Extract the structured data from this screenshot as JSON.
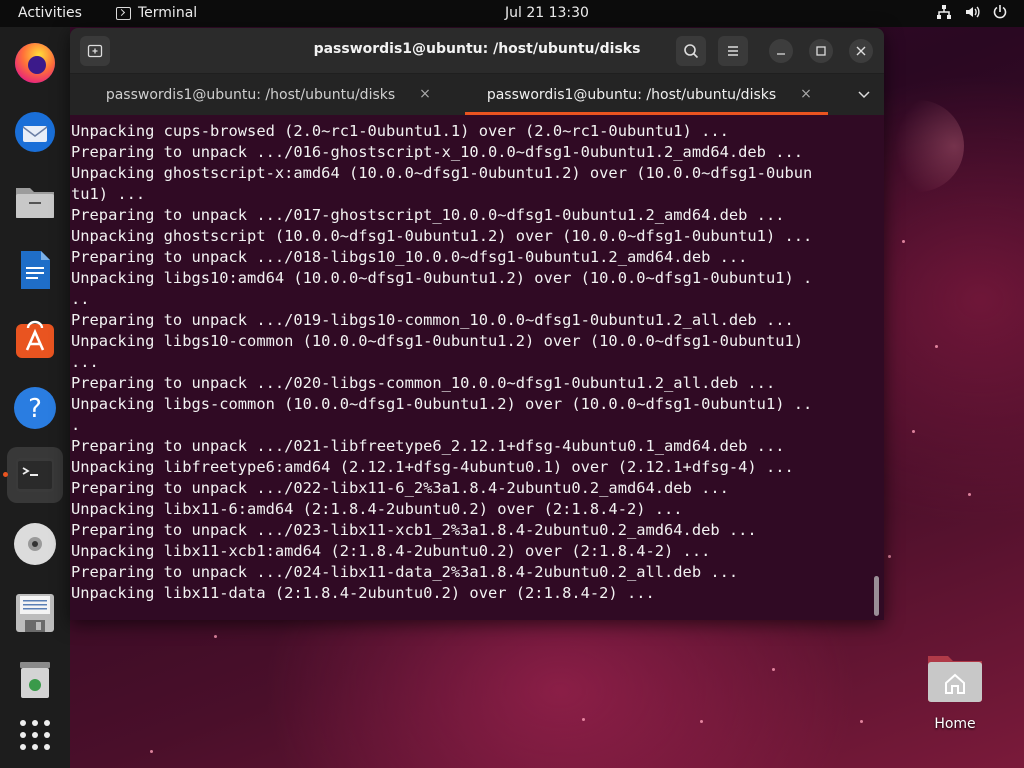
{
  "topbar": {
    "activities": "Activities",
    "app_name": "Terminal",
    "clock": "Jul 21  13:30"
  },
  "dock": {
    "items": [
      {
        "name": "firefox",
        "icon": "firefox-icon"
      },
      {
        "name": "thunderbird",
        "icon": "thunderbird-icon"
      },
      {
        "name": "files",
        "icon": "files-icon"
      },
      {
        "name": "libreoffice-writer",
        "icon": "writer-icon"
      },
      {
        "name": "app-center",
        "icon": "app-center-icon"
      },
      {
        "name": "help",
        "icon": "help-icon"
      },
      {
        "name": "terminal",
        "icon": "terminal-icon"
      },
      {
        "name": "cd-drive",
        "icon": "disc-icon"
      },
      {
        "name": "floppy",
        "icon": "floppy-icon"
      },
      {
        "name": "trash",
        "icon": "trash-icon"
      },
      {
        "name": "show-apps",
        "icon": "grid-icon"
      }
    ]
  },
  "window": {
    "title": "passwordis1@ubuntu: /host/ubuntu/disks",
    "tabs": [
      {
        "label": "passwordis1@ubuntu: /host/ubuntu/disks",
        "active": false
      },
      {
        "label": "passwordis1@ubuntu: /host/ubuntu/disks",
        "active": true
      }
    ],
    "close_glyph": "×"
  },
  "terminal": {
    "lines": [
      "Unpacking cups-browsed (2.0~rc1-0ubuntu1.1) over (2.0~rc1-0ubuntu1) ...",
      "Preparing to unpack .../016-ghostscript-x_10.0.0~dfsg1-0ubuntu1.2_amd64.deb ...",
      "Unpacking ghostscript-x:amd64 (10.0.0~dfsg1-0ubuntu1.2) over (10.0.0~dfsg1-0ubun",
      "tu1) ...",
      "Preparing to unpack .../017-ghostscript_10.0.0~dfsg1-0ubuntu1.2_amd64.deb ...",
      "Unpacking ghostscript (10.0.0~dfsg1-0ubuntu1.2) over (10.0.0~dfsg1-0ubuntu1) ...",
      "Preparing to unpack .../018-libgs10_10.0.0~dfsg1-0ubuntu1.2_amd64.deb ...",
      "Unpacking libgs10:amd64 (10.0.0~dfsg1-0ubuntu1.2) over (10.0.0~dfsg1-0ubuntu1) .",
      "..",
      "Preparing to unpack .../019-libgs10-common_10.0.0~dfsg1-0ubuntu1.2_all.deb ...",
      "Unpacking libgs10-common (10.0.0~dfsg1-0ubuntu1.2) over (10.0.0~dfsg1-0ubuntu1)",
      "...",
      "Preparing to unpack .../020-libgs-common_10.0.0~dfsg1-0ubuntu1.2_all.deb ...",
      "Unpacking libgs-common (10.0.0~dfsg1-0ubuntu1.2) over (10.0.0~dfsg1-0ubuntu1) ..",
      ".",
      "Preparing to unpack .../021-libfreetype6_2.12.1+dfsg-4ubuntu0.1_amd64.deb ...",
      "Unpacking libfreetype6:amd64 (2.12.1+dfsg-4ubuntu0.1) over (2.12.1+dfsg-4) ...",
      "Preparing to unpack .../022-libx11-6_2%3a1.8.4-2ubuntu0.2_amd64.deb ...",
      "Unpacking libx11-6:amd64 (2:1.8.4-2ubuntu0.2) over (2:1.8.4-2) ...",
      "Preparing to unpack .../023-libx11-xcb1_2%3a1.8.4-2ubuntu0.2_amd64.deb ...",
      "Unpacking libx11-xcb1:amd64 (2:1.8.4-2ubuntu0.2) over (2:1.8.4-2) ...",
      "Preparing to unpack .../024-libx11-data_2%3a1.8.4-2ubuntu0.2_all.deb ...",
      "Unpacking libx11-data (2:1.8.4-2ubuntu0.2) over (2:1.8.4-2) ..."
    ]
  },
  "desktop": {
    "home_label": "Home"
  },
  "colors": {
    "accent": "#e95420",
    "terminal_bg": "#300a24",
    "terminal_fg": "#f2f2f2"
  }
}
